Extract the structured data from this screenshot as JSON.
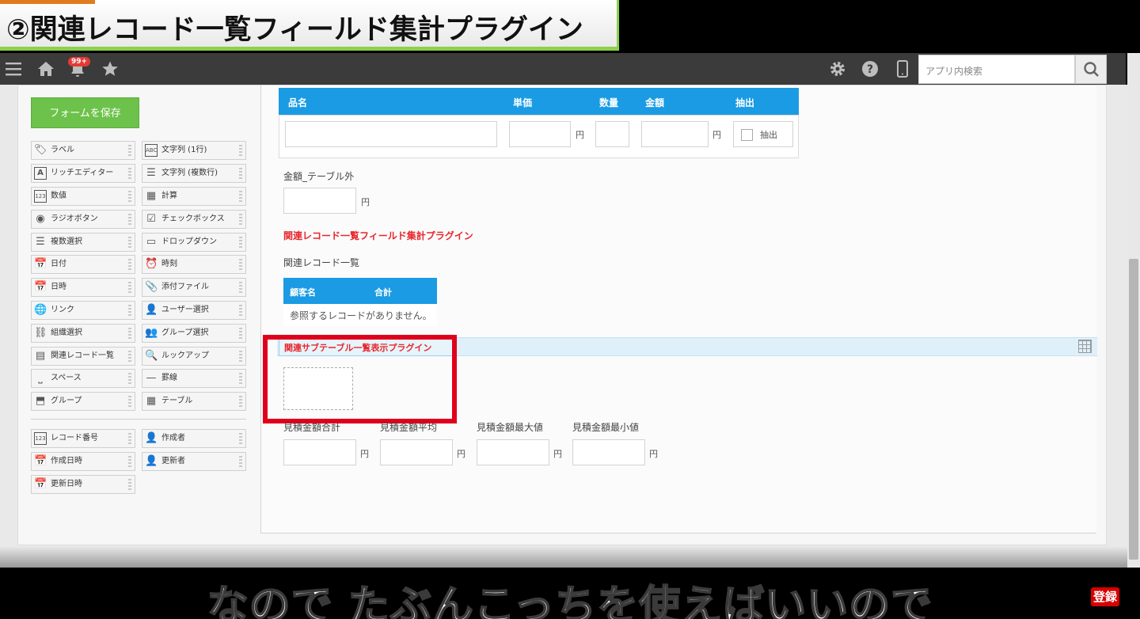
{
  "title_banner": {
    "text": "②関連レコード一覧フィールド集計プラグイン"
  },
  "topbar": {
    "menu_icon": "hamburger-icon",
    "home_icon": "home-icon",
    "notification_badge": "99+",
    "star_icon": "star-icon",
    "settings_icon": "gear-icon",
    "help_icon": "help-icon",
    "mobile_icon": "mobile-icon",
    "search_placeholder": "アプリ内検索"
  },
  "palette": {
    "save_label": "フォームを保存",
    "left_items": [
      "ラベル",
      "リッチエディター",
      "数値",
      "ラジオボタン",
      "複数選択",
      "日付",
      "日時",
      "リンク",
      "組織選択",
      "関連レコード一覧",
      "スペース",
      "グループ"
    ],
    "right_items": [
      "文字列 (1行)",
      "文字列 (複数行)",
      "計算",
      "チェックボックス",
      "ドロップダウン",
      "時刻",
      "添付ファイル",
      "ユーザー選択",
      "グループ選択",
      "ルックアップ",
      "罫線",
      "テーブル"
    ],
    "system_left": [
      "レコード番号",
      "作成日時",
      "更新日時"
    ],
    "system_right": [
      "作成者",
      "更新者"
    ]
  },
  "form": {
    "table_headers": [
      "品名",
      "単価",
      "数量",
      "金額",
      "抽出"
    ],
    "yen": "円",
    "checkbox_label": "抽出",
    "outside_label": "金額_テーブル外",
    "plugin_label": "関連レコード一覧フィールド集計プラグイン",
    "related_list_label": "関連レコード一覧",
    "related_headers": [
      "顧客名",
      "合計"
    ],
    "related_empty": "参照するレコードがありません。",
    "subtable_plugin_label": "関連サブテーブル一覧表示プラグイン",
    "estimate_labels": [
      "見積金額合計",
      "見積金額平均",
      "見積金額最大値",
      "見積金額最小値"
    ]
  },
  "subtitle": {
    "text": "なので たぶんこっちを使えばいいので"
  },
  "subscribe_badge": "登録"
}
